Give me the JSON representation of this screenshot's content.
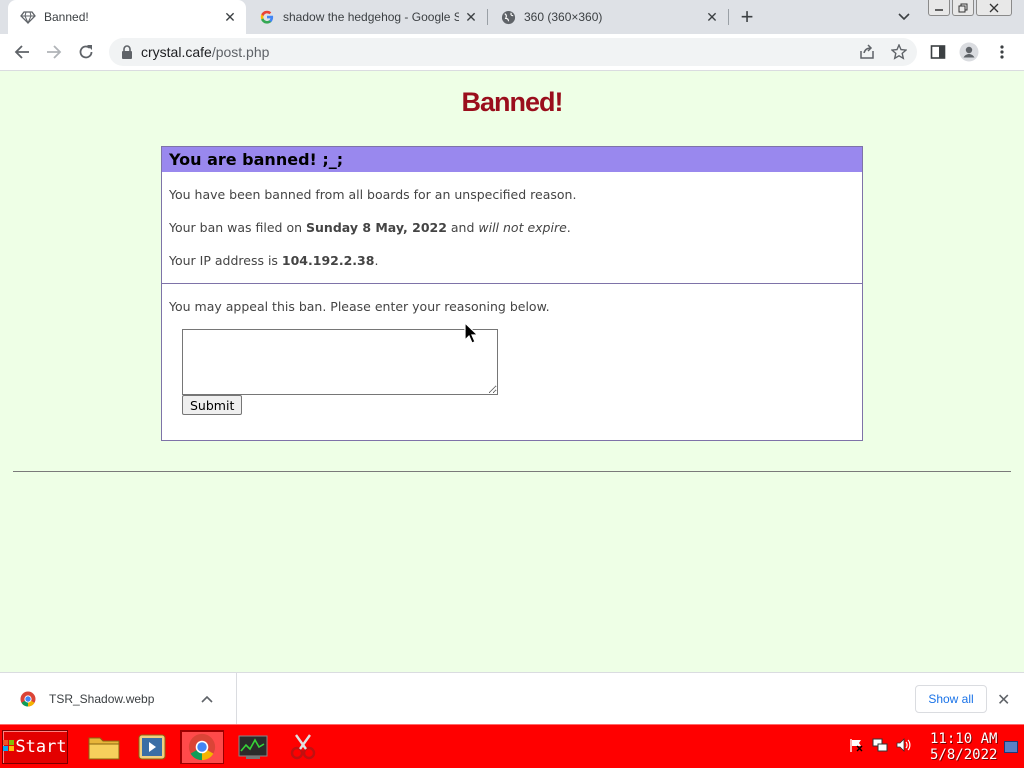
{
  "tabs": [
    {
      "title": "Banned!",
      "favicon": "diamond-icon",
      "active": true
    },
    {
      "title": "shadow the hedgehog - Google Sea",
      "favicon": "google-icon",
      "active": false
    },
    {
      "title": "360 (360×360)",
      "favicon": "globe-icon",
      "active": false
    }
  ],
  "toolbar": {
    "url_host": "crystal.cafe",
    "url_path": "/post.php"
  },
  "page": {
    "title": "Banned!",
    "ban_heading": "You are banned! ;_;",
    "ban_reason_text": "You have been banned from all boards for an unspecified reason.",
    "ban_filed_prefix": "Your ban was filed on ",
    "ban_date": "Sunday 8 May, 2022",
    "ban_filed_mid": " and ",
    "ban_expiry": "will not expire",
    "ban_filed_suffix": ".",
    "ip_prefix": "Your IP address is ",
    "ip_address": "104.192.2.38",
    "ip_suffix": ".",
    "appeal_text": "You may appeal this ban. Please enter your reasoning below.",
    "appeal_value": "",
    "submit_label": "Submit"
  },
  "downloads": {
    "file_name": "TSR_Shadow.webp",
    "show_all_label": "Show all"
  },
  "taskbar": {
    "start_label": "Start",
    "clock_time": "11:10 AM",
    "clock_date": "5/8/2022"
  },
  "colors": {
    "page_bg": "#eeffe6",
    "title_red": "#9a0e1c",
    "ban_header": "#9988ee",
    "taskbar": "#ff0000"
  }
}
